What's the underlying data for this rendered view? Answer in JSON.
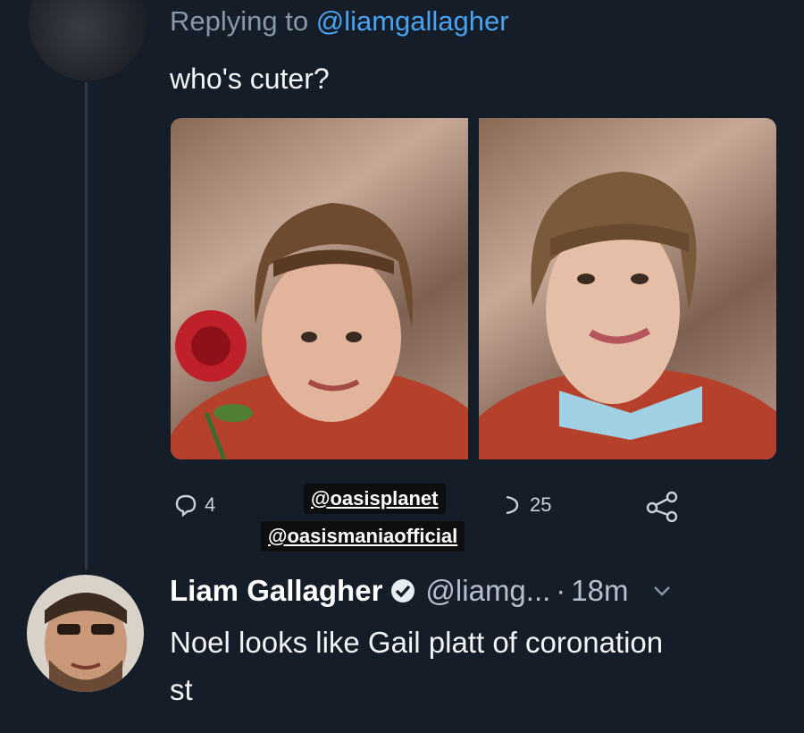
{
  "tweet": {
    "reply_prefix": "Replying to ",
    "reply_to_handle": "@liamgallagher",
    "text": "who's cuter?",
    "photos": [
      {
        "subject": "child with rose"
      },
      {
        "subject": "child with collar"
      }
    ]
  },
  "actions": {
    "reply_count": "4",
    "like_count": "25"
  },
  "stickers": [
    "@oasisplanet",
    "@oasismaniaofficial"
  ],
  "reply": {
    "name": "Liam Gallagher",
    "handle": "@liamg...",
    "separator": "·",
    "time": "18m",
    "text": "Noel looks like Gail platt of coronation st"
  },
  "colors": {
    "background": "#151d29",
    "link": "#4aa3f0",
    "muted": "#8899a6"
  },
  "icons": [
    "reply-icon",
    "like-icon",
    "share-icon",
    "verified-icon",
    "chevron-down-icon"
  ]
}
